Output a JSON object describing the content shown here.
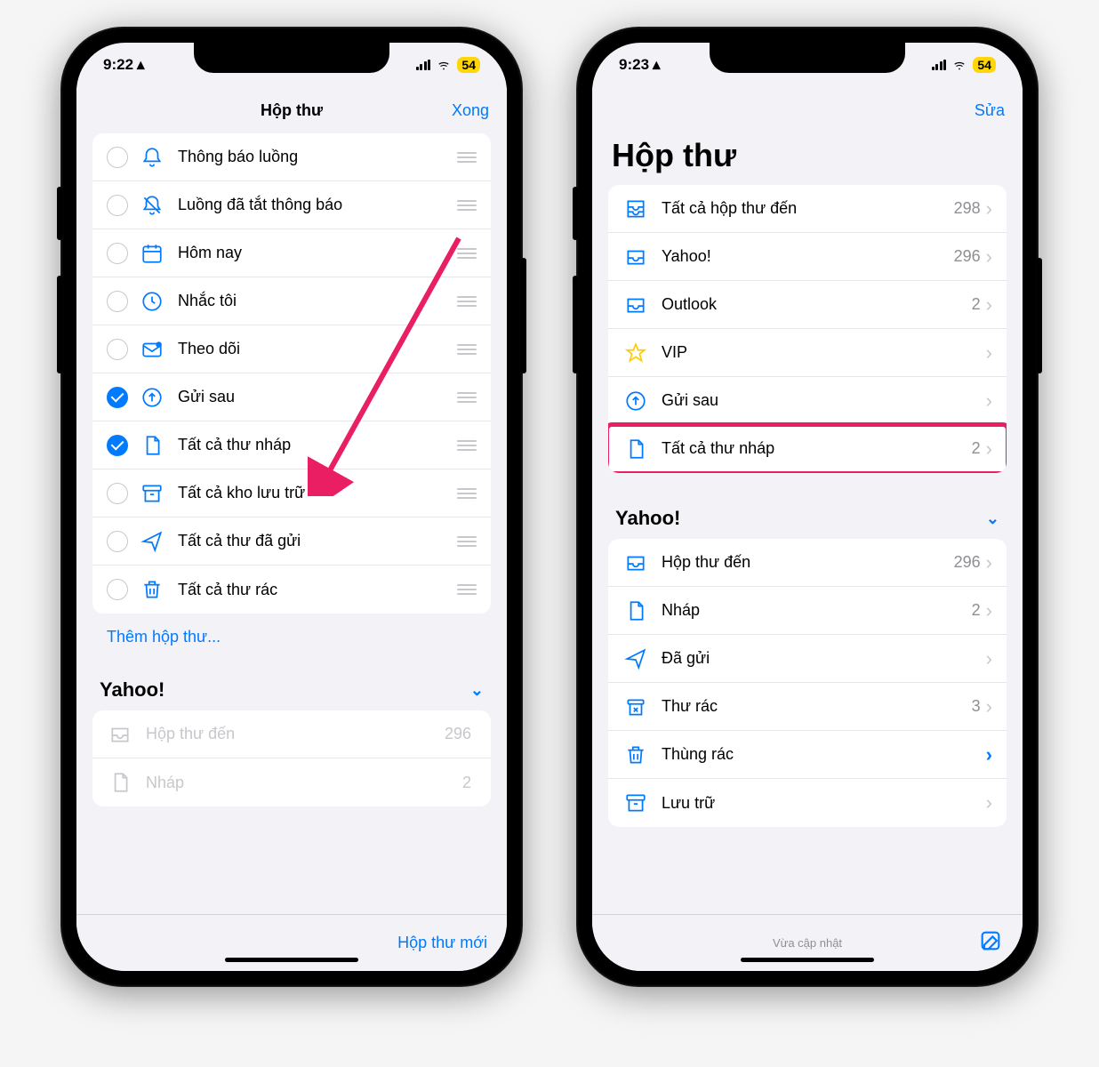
{
  "status": {
    "time_left": "9:22",
    "time_right": "9:23",
    "battery": "54"
  },
  "left": {
    "nav": {
      "title": "Hộp thư",
      "action": "Xong"
    },
    "rows": [
      {
        "icon": "bell",
        "label": "Thông báo luồng",
        "checked": false
      },
      {
        "icon": "bell-slash",
        "label": "Luồng đã tắt thông báo",
        "checked": false
      },
      {
        "icon": "calendar",
        "label": "Hôm nay",
        "checked": false
      },
      {
        "icon": "clock",
        "label": "Nhắc tôi",
        "checked": false
      },
      {
        "icon": "envelope-badge",
        "label": "Theo dõi",
        "checked": false
      },
      {
        "icon": "tray-up",
        "label": "Gửi sau",
        "checked": true
      },
      {
        "icon": "doc",
        "label": "Tất cả thư nháp",
        "checked": true
      },
      {
        "icon": "archivebox",
        "label": "Tất cả kho lưu trữ",
        "checked": false
      },
      {
        "icon": "paperplane",
        "label": "Tất cả thư đã gửi",
        "checked": false
      },
      {
        "icon": "trash",
        "label": "Tất cả thư rác",
        "checked": false
      }
    ],
    "add_mailbox": "Thêm hộp thư...",
    "section": "Yahoo!",
    "sub_rows": [
      {
        "icon": "tray",
        "label": "Hộp thư đến",
        "count": "296"
      },
      {
        "icon": "doc",
        "label": "Nháp",
        "count": "2"
      }
    ],
    "bottom": "Hộp thư mới"
  },
  "right": {
    "nav": {
      "action": "Sửa"
    },
    "title": "Hộp thư",
    "main_rows": [
      {
        "icon": "tray-all",
        "label": "Tất cả hộp thư đến",
        "count": "298"
      },
      {
        "icon": "tray",
        "label": "Yahoo!",
        "count": "296"
      },
      {
        "icon": "tray",
        "label": "Outlook",
        "count": "2"
      },
      {
        "icon": "star",
        "label": "VIP",
        "count": ""
      },
      {
        "icon": "tray-up",
        "label": "Gửi sau",
        "count": ""
      },
      {
        "icon": "doc",
        "label": "Tất cả thư nháp",
        "count": "2",
        "highlight": true
      }
    ],
    "section": "Yahoo!",
    "sub_rows": [
      {
        "icon": "tray",
        "label": "Hộp thư đến",
        "count": "296"
      },
      {
        "icon": "doc",
        "label": "Nháp",
        "count": "2"
      },
      {
        "icon": "paperplane",
        "label": "Đã gửi",
        "count": ""
      },
      {
        "icon": "xmark-bin",
        "label": "Thư rác",
        "count": "3"
      },
      {
        "icon": "trash",
        "label": "Thùng rác",
        "count": "",
        "blue_chev": true
      },
      {
        "icon": "archivebox",
        "label": "Lưu trữ",
        "count": ""
      }
    ],
    "status": "Vừa cập nhật"
  }
}
